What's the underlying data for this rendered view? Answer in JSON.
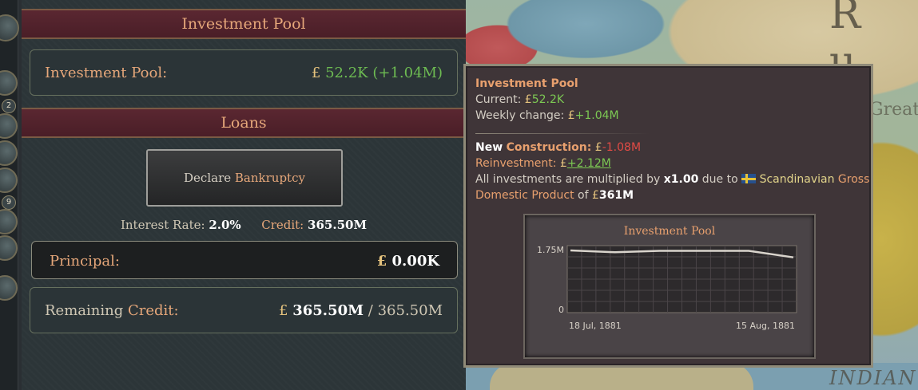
{
  "left_panel": {
    "investment_pool_header": "Investment Pool",
    "investment_pool_label": "Investment Pool:",
    "investment_pool_value": "52.2K",
    "investment_pool_change": "(+1.04M)",
    "loans_header": "Loans",
    "declare_button": {
      "word1": "Declare",
      "word2": "Bankruptcy"
    },
    "interest_rate_label": "Interest Rate:",
    "interest_rate_value": "2.0%",
    "credit_label": "Credit:",
    "credit_value": "365.50M",
    "principal_label": "Principal:",
    "principal_value": "0.00K",
    "remaining_label_1": "Remaining",
    "remaining_label_2": "Credit:",
    "remaining_value": "365.50M",
    "remaining_total": "/ 365.50M",
    "currency_symbol": "£"
  },
  "left_rail": {
    "badges": [
      "2",
      "9"
    ]
  },
  "tooltip": {
    "title": "Investment Pool",
    "current_label": "Current:",
    "current_value": "52.2K",
    "weekly_label": "Weekly change:",
    "weekly_value": "+1.04M",
    "new_construction_word1": "New",
    "new_construction_word2": "Construction:",
    "new_construction_value": "-1.08M",
    "reinvestment_label": "Reinvestment:",
    "reinvestment_value": "+2.12M",
    "multiplier_prefix": "All investments are multiplied by",
    "multiplier_value": "x1.00",
    "multiplier_due": "due to",
    "country": "Scandinavian",
    "gdp_word1": "Gross",
    "gdp_line2": "Domestic Product",
    "gdp_of": "of",
    "gdp_value": "361M",
    "currency_symbol": "£"
  },
  "map": {
    "label_ru": "R u",
    "label_great": "Great",
    "label_indian": "INDIAN"
  },
  "chart_data": {
    "type": "line",
    "title": "Investment Pool",
    "x": [
      "18 Jul, 1881",
      "",
      "",
      "",
      "",
      "15 Aug, 1881"
    ],
    "x_tick_labels": [
      "18 Jul, 1881",
      "15 Aug, 1881"
    ],
    "y_tick_labels": [
      "1.75M",
      "0"
    ],
    "ylim": [
      0,
      1.75
    ],
    "series": [
      {
        "values": [
          1.75,
          1.7,
          1.74,
          1.74,
          1.74,
          1.56
        ]
      }
    ],
    "grid": true
  }
}
